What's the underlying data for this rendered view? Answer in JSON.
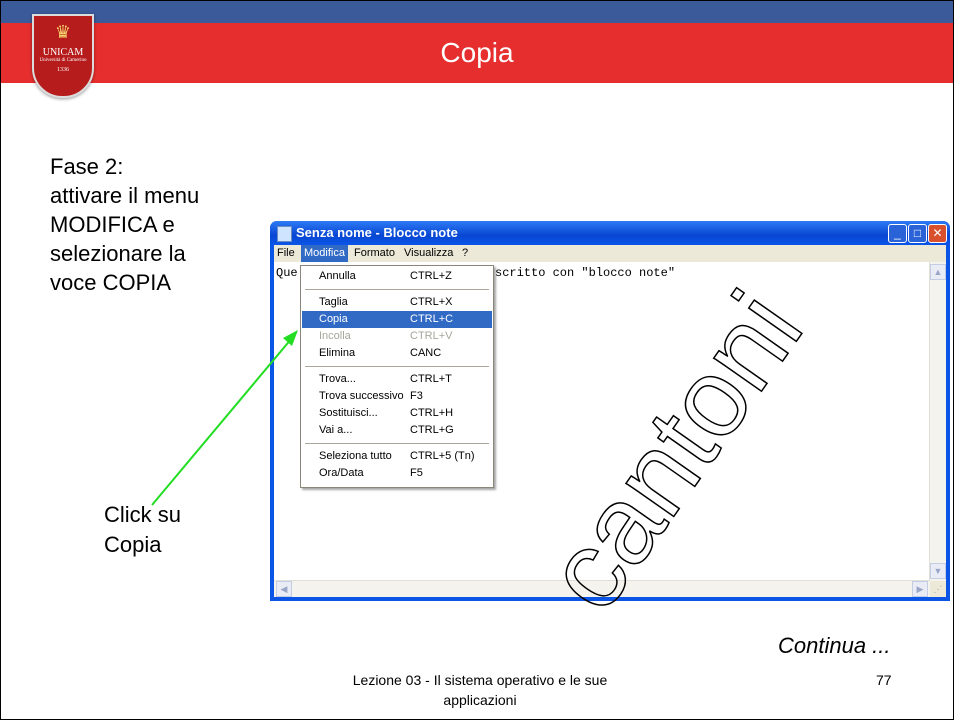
{
  "slide": {
    "title": "Copia",
    "logo": {
      "name": "UNICAM",
      "subtitle": "Università di Camerino",
      "year": "1336"
    },
    "left_text": [
      "Fase 2:",
      "attivare il menu",
      "MODIFICA e",
      "selezionare la",
      "voce COPIA"
    ],
    "click_text": [
      "Click su",
      "Copia"
    ],
    "continua": "Continua ...",
    "footer": [
      "Lezione 03 - Il sistema operativo e le sue",
      "applicazioni"
    ],
    "page_number": "77",
    "watermark": "cantoni",
    "colors": {
      "title_bar": "#e62e2e",
      "top_bar": "#3b5a9a",
      "arrow": "#22dd22",
      "menu_highlight": "#316ac5"
    }
  },
  "window": {
    "title": "Senza nome - Blocco note",
    "buttons": [
      "minimize-icon",
      "maximize-icon",
      "close-icon"
    ],
    "menus": [
      {
        "label": "File",
        "active": false
      },
      {
        "label": "Modifica",
        "active": true
      },
      {
        "label": "Formato",
        "active": false
      },
      {
        "label": "Visualizza",
        "active": false
      },
      {
        "label": "?",
        "active": false
      }
    ],
    "text_visible_left": "Que",
    "text_visible_right": "scritto con \"blocco note\""
  },
  "menu": {
    "items": [
      {
        "label": "Annulla",
        "shortcut": "CTRL+Z",
        "state": "normal"
      },
      {
        "label": "Taglia",
        "shortcut": "CTRL+X",
        "state": "normal"
      },
      {
        "label": "Copia",
        "shortcut": "CTRL+C",
        "state": "selected"
      },
      {
        "label": "Incolla",
        "shortcut": "CTRL+V",
        "state": "disabled"
      },
      {
        "label": "Elimina",
        "shortcut": "CANC",
        "state": "normal"
      },
      {
        "label": "Trova...",
        "shortcut": "CTRL+T",
        "state": "normal"
      },
      {
        "label": "Trova successivo",
        "shortcut": "F3",
        "state": "normal"
      },
      {
        "label": "Sostituisci...",
        "shortcut": "CTRL+H",
        "state": "normal"
      },
      {
        "label": "Vai a...",
        "shortcut": "CTRL+G",
        "state": "normal"
      },
      {
        "label": "Seleziona tutto",
        "shortcut": "CTRL+5 (Tn)",
        "state": "normal"
      },
      {
        "label": "Ora/Data",
        "shortcut": "F5",
        "state": "normal"
      }
    ]
  }
}
